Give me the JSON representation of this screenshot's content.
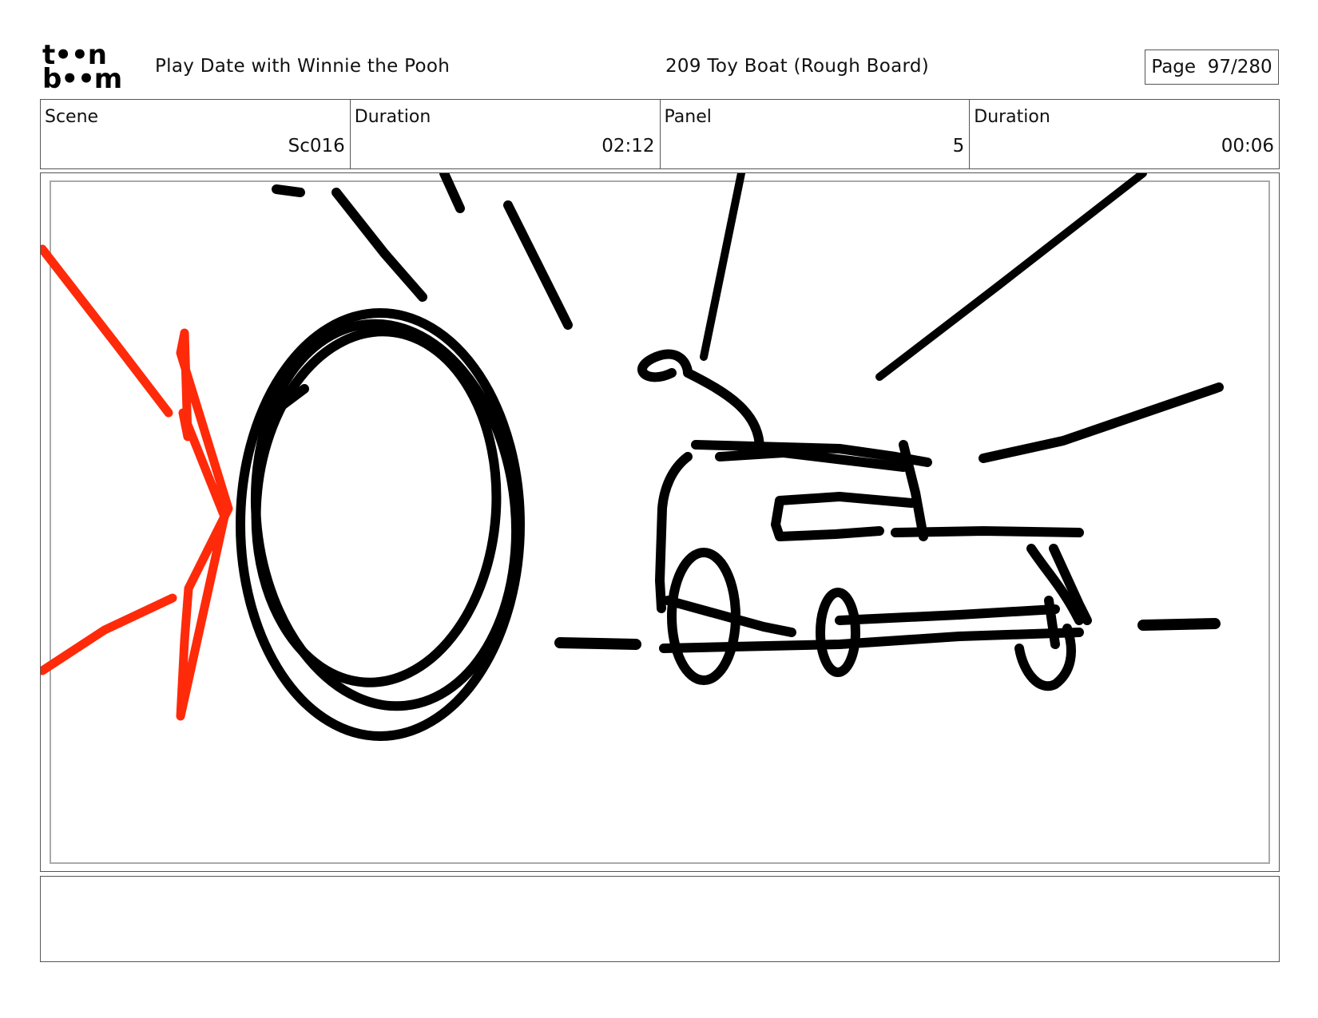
{
  "logo": {
    "line1": "t••n",
    "line2": "b••m"
  },
  "header": {
    "project_title": "Play Date with Winnie the Pooh",
    "episode_title": "209 Toy Boat (Rough Board)",
    "page_label": "Page",
    "page_number": "97/280"
  },
  "info": [
    {
      "label": "Scene",
      "value": "Sc016"
    },
    {
      "label": "Duration",
      "value": "02:12"
    },
    {
      "label": "Panel",
      "value": "5"
    },
    {
      "label": "Duration",
      "value": "00:06"
    }
  ],
  "colors": {
    "sketch_line": "#000000",
    "action_accent": "#ff2a0a",
    "frame_border": "#555555"
  },
  "notes": ""
}
